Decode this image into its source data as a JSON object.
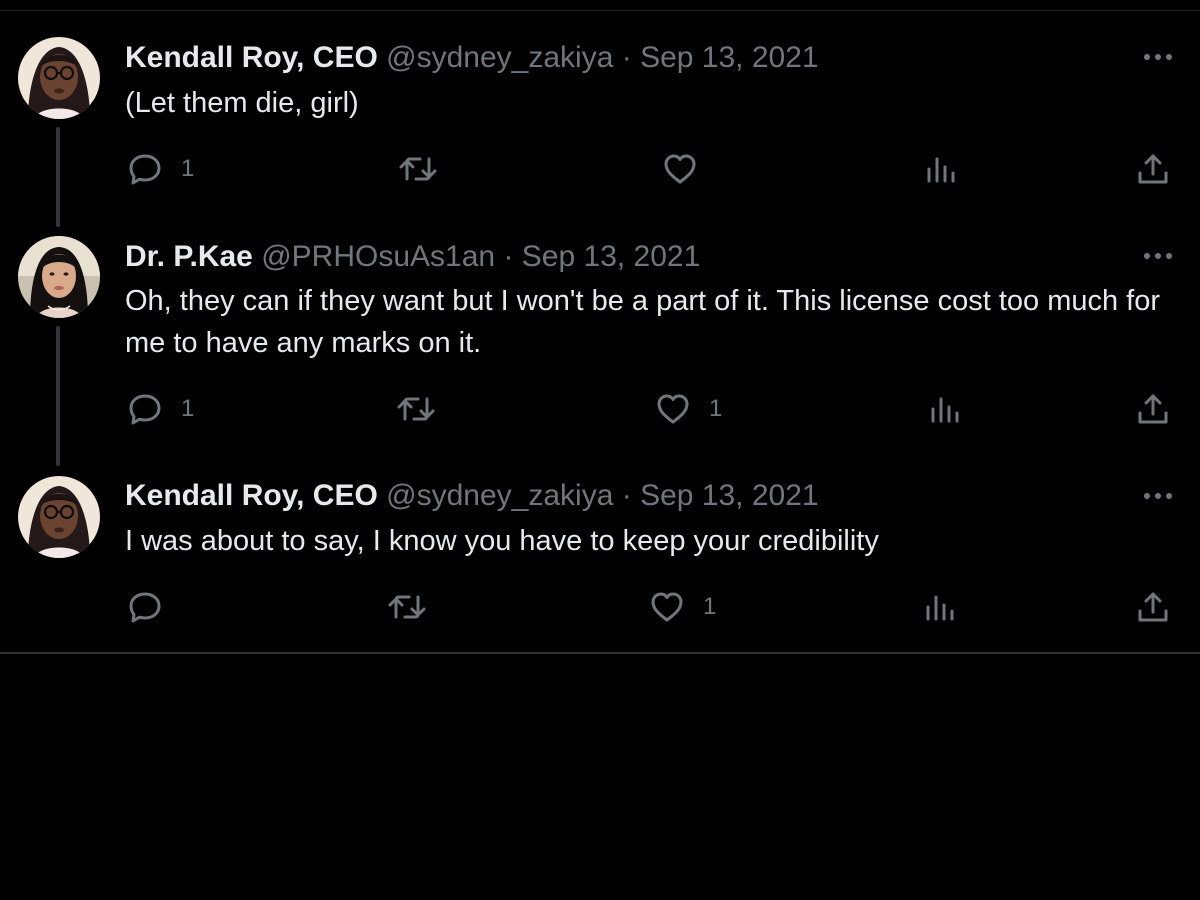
{
  "tweets": [
    {
      "display_name": "Kendall Roy, CEO",
      "handle": "@sydney_zakiya",
      "separator": "·",
      "date": "Sep 13, 2021",
      "text": "(Let them die, girl)",
      "reply_count": "1",
      "retweet_count": "",
      "like_count": ""
    },
    {
      "display_name": "Dr. P.Kae",
      "handle": "@PRHOsuAs1an",
      "separator": "·",
      "date": "Sep 13, 2021",
      "text": "Oh, they can if they want but I won't be a part of it. This license cost too much for me to have any marks on it.",
      "reply_count": "1",
      "retweet_count": "",
      "like_count": "1"
    },
    {
      "display_name": "Kendall Roy, CEO",
      "handle": "@sydney_zakiya",
      "separator": "·",
      "date": "Sep 13, 2021",
      "text": "I was about to say, I know you have to keep your credibility",
      "reply_count": "",
      "retweet_count": "",
      "like_count": "1"
    }
  ],
  "icons": {
    "reply": "reply-icon",
    "retweet": "retweet-icon",
    "like": "like-icon",
    "views": "views-icon",
    "share": "share-icon",
    "more": "more-icon"
  },
  "colors": {
    "background": "#000000",
    "primary_text": "#e7e9ea",
    "secondary_text": "#71767b",
    "thread_line": "#333639",
    "divider": "#2f3336"
  }
}
